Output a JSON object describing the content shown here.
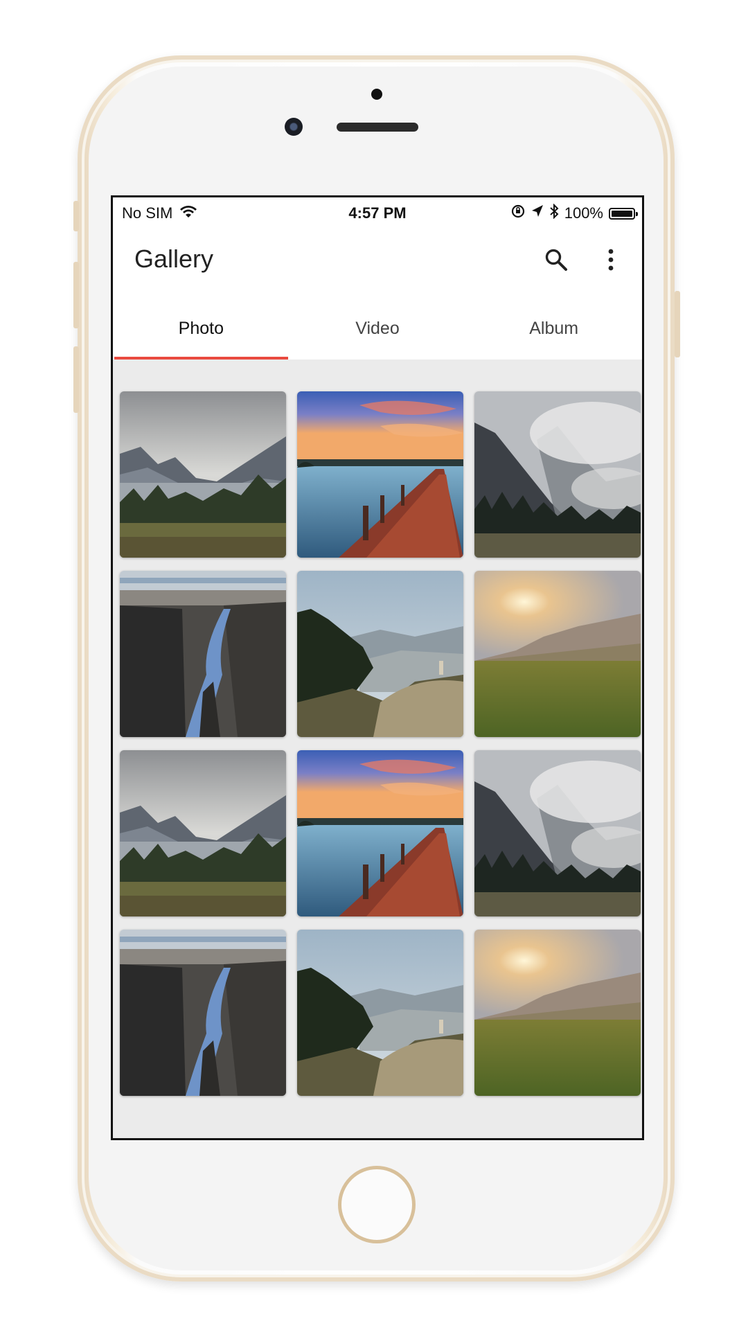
{
  "status_bar": {
    "carrier": "No SIM",
    "time": "4:57 PM",
    "battery": "100%"
  },
  "app_bar": {
    "title": "Gallery",
    "icons": [
      "search-icon",
      "more-vert-icon"
    ]
  },
  "tabs": [
    {
      "label": "Photo",
      "active": true
    },
    {
      "label": "Video",
      "active": false
    },
    {
      "label": "Album",
      "active": false
    }
  ],
  "accent_color": "#e94a3f",
  "photos": [
    "lake-mountains",
    "pier-sunset",
    "misty-mountains",
    "river-canyon",
    "forest-valley",
    "meadow-sunset",
    "lake-mountains",
    "pier-sunset",
    "misty-mountains",
    "river-canyon",
    "forest-valley",
    "meadow-sunset"
  ]
}
